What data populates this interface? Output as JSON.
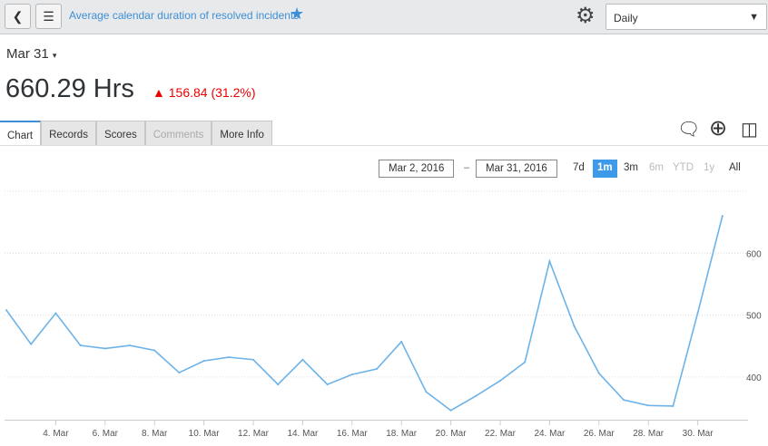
{
  "header": {
    "title": "Average calendar duration of resolved incidents",
    "frequency": "Daily",
    "back_icon": "chevron-left-icon",
    "menu_icon": "hamburger-icon",
    "star_icon": "star-icon",
    "gear_icon": "gear-icon"
  },
  "summary": {
    "date": "Mar 31",
    "value": "660.29 Hrs",
    "delta": "156.84 (31.2%)",
    "delta_color": "#e00000"
  },
  "tabs": [
    {
      "label": "Chart"
    },
    {
      "label": "Records"
    },
    {
      "label": "Scores"
    },
    {
      "label": "Comments"
    },
    {
      "label": "More Info"
    }
  ],
  "toolbar_icons": [
    "comment-icon",
    "crosshair-icon",
    "layout-icon"
  ],
  "range": {
    "from": "Mar 2, 2016",
    "to": "Mar 31, 2016",
    "separator": "–",
    "buttons": [
      {
        "label": "7d"
      },
      {
        "label": "1m"
      },
      {
        "label": "3m"
      },
      {
        "label": "6m"
      },
      {
        "label": "YTD"
      },
      {
        "label": "1y"
      },
      {
        "label": "All"
      }
    ],
    "selected": "1m"
  },
  "chart_data": {
    "type": "line",
    "line_color": "#6db3e8",
    "grid": true,
    "ylim": [
      331,
      700
    ],
    "x_ticks": [
      "4. Mar",
      "6. Mar",
      "8. Mar",
      "10. Mar",
      "12. Mar",
      "14. Mar",
      "16. Mar",
      "18. Mar",
      "20. Mar",
      "22. Mar",
      "24. Mar",
      "26. Mar",
      "28. Mar",
      "30. Mar"
    ],
    "y_ticks": [
      "400",
      "500",
      "600"
    ],
    "x_days": [
      2,
      3,
      4,
      5,
      6,
      7,
      8,
      9,
      10,
      11,
      12,
      13,
      14,
      15,
      16,
      17,
      18,
      19,
      20,
      21,
      22,
      23,
      24,
      25,
      26,
      27,
      28,
      29,
      30,
      31
    ],
    "values": [
      508,
      453,
      503,
      451,
      446,
      451,
      443,
      407,
      426,
      432,
      428,
      388,
      428,
      388,
      404,
      413,
      457,
      376,
      346,
      369,
      394,
      424,
      587,
      482,
      406,
      363,
      354,
      353,
      503.45,
      660.29
    ]
  }
}
